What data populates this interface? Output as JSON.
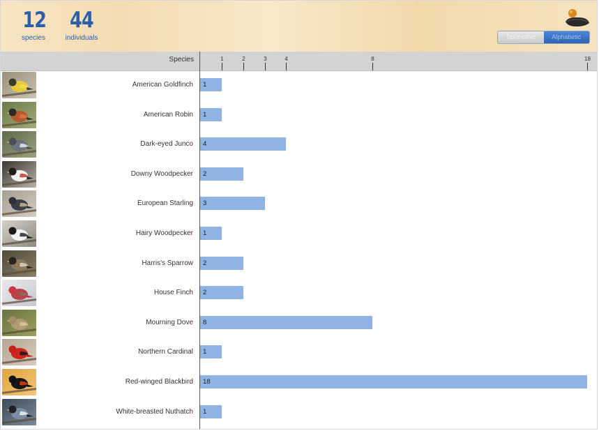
{
  "summary": {
    "species_count": "12",
    "species_label": "species",
    "individuals_count": "44",
    "individuals_label": "individuals"
  },
  "sort_toggle": {
    "options": [
      "Taxonomic",
      "Alphabetic"
    ],
    "selected": "Alphabetic"
  },
  "icons": {
    "feeder": "bird-feeder-icon"
  },
  "colors": {
    "accent": "#2b5fab",
    "bar": "#8fb3e2",
    "axis_band": "#d3d3d3"
  },
  "chart_data": {
    "type": "bar",
    "orientation": "horizontal",
    "ylabel": "Species",
    "xlabel": "",
    "axis_ticks": [
      1,
      2,
      3,
      4,
      8,
      18
    ],
    "xlim": [
      0,
      18
    ],
    "categories": [
      "American Goldfinch",
      "American Robin",
      "Dark-eyed Junco",
      "Downy Woodpecker",
      "European Starling",
      "Hairy Woodpecker",
      "Harris's Sparrow",
      "House Finch",
      "Mourning Dove",
      "Northern Cardinal",
      "Red-winged Blackbird",
      "White-breasted Nuthatch"
    ],
    "values": [
      1,
      1,
      4,
      2,
      3,
      1,
      2,
      2,
      8,
      1,
      18,
      1
    ]
  },
  "species_rows": [
    {
      "name": "American Goldfinch",
      "count": "1",
      "photo": "american-goldfinch-photo"
    },
    {
      "name": "American Robin",
      "count": "1",
      "photo": "american-robin-photo"
    },
    {
      "name": "Dark-eyed Junco",
      "count": "4",
      "photo": "dark-eyed-junco-photo"
    },
    {
      "name": "Downy Woodpecker",
      "count": "2",
      "photo": "downy-woodpecker-photo"
    },
    {
      "name": "European Starling",
      "count": "3",
      "photo": "european-starling-photo"
    },
    {
      "name": "Hairy Woodpecker",
      "count": "1",
      "photo": "hairy-woodpecker-photo"
    },
    {
      "name": "Harris's Sparrow",
      "count": "2",
      "photo": "harriss-sparrow-photo"
    },
    {
      "name": "House Finch",
      "count": "2",
      "photo": "house-finch-photo"
    },
    {
      "name": "Mourning Dove",
      "count": "8",
      "photo": "mourning-dove-photo"
    },
    {
      "name": "Northern Cardinal",
      "count": "1",
      "photo": "northern-cardinal-photo"
    },
    {
      "name": "Red-winged Blackbird",
      "count": "18",
      "photo": "red-winged-blackbird-photo"
    },
    {
      "name": "White-breasted Nuthatch",
      "count": "1",
      "photo": "white-breasted-nuthatch-photo"
    }
  ]
}
